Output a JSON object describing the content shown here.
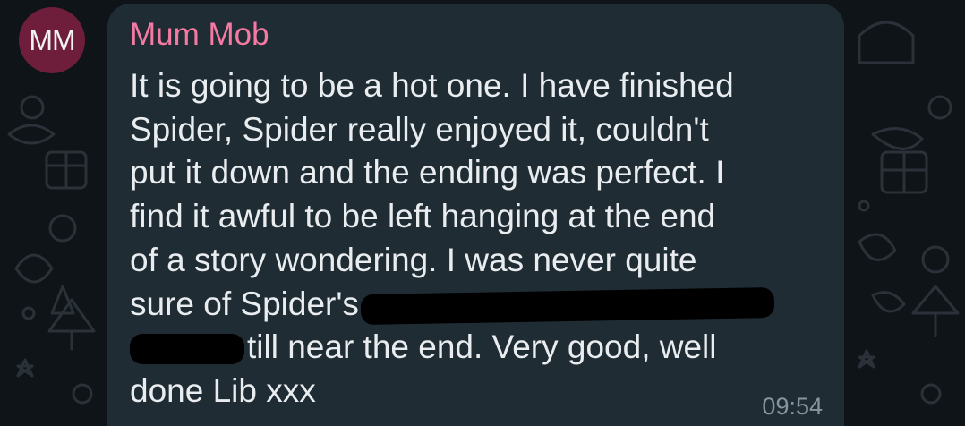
{
  "chat": {
    "avatar_initials": "MM",
    "sender_name": "Mum Mob",
    "message_lines": [
      "It is going to be a hot one.  I have finished",
      "Spider,  Spider really enjoyed it, couldn't",
      "put it down and the ending was perfect. I",
      "find it awful to be left hanging at the end",
      "of a story wondering. I was never quite",
      "sure of Spider's",
      "till near the end. Very good, well",
      "done Lib xxx"
    ],
    "time": "09:54"
  },
  "colors": {
    "background": "#0f1419",
    "bubble": "#1f2c34",
    "sender_name": "#f57aa3",
    "avatar": "#6e1d3a",
    "message_text": "#e9edef",
    "timestamp": "#8696a0"
  }
}
